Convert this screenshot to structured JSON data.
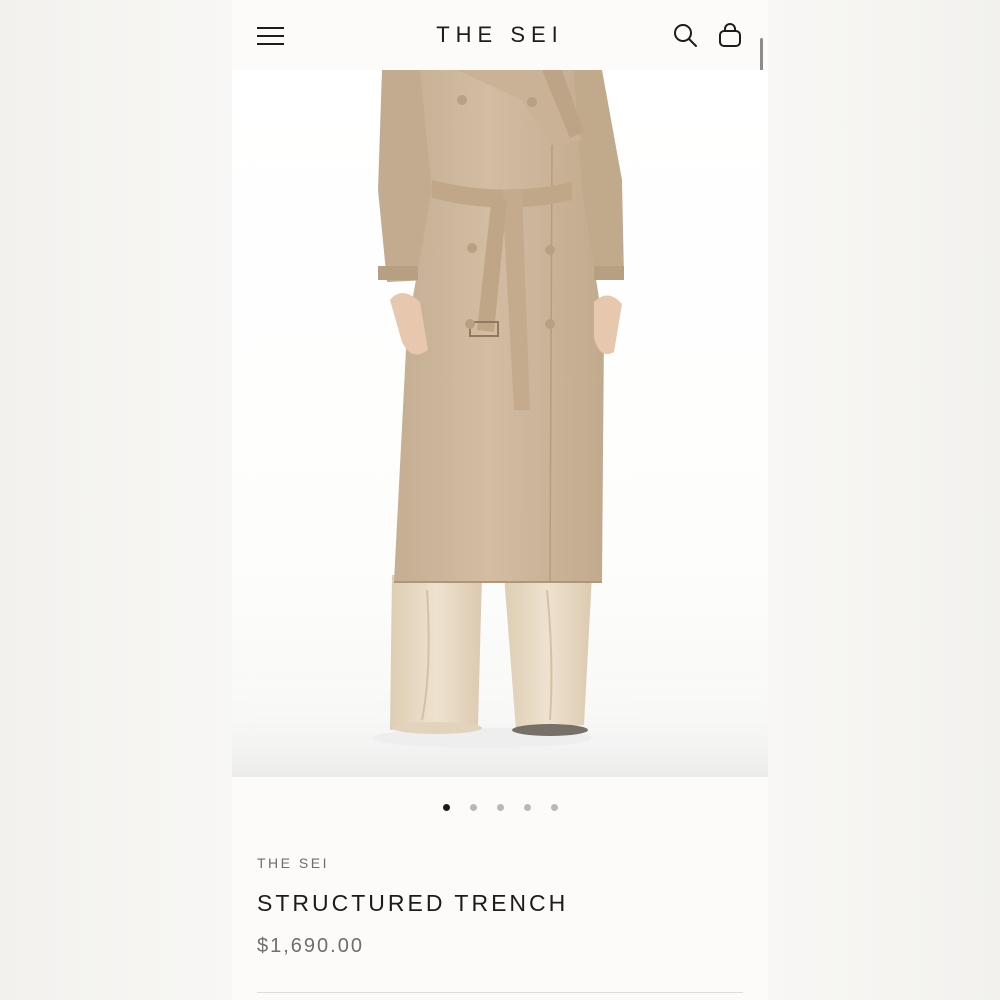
{
  "header": {
    "brand": "THE SEI",
    "menu_icon": "hamburger-menu-icon",
    "search_icon": "search-icon",
    "cart_icon": "shopping-bag-icon"
  },
  "gallery": {
    "image_subject": "model wearing beige belted trench coat over cream wide-leg trousers",
    "slide_count": 5,
    "active_slide": 1
  },
  "product": {
    "vendor": "THE SEI",
    "title": "STRUCTURED TRENCH",
    "price": "$1,690.00"
  },
  "colors": {
    "background": "#fcfbf9",
    "text": "#1c1c1c",
    "muted_text": "#6e6e6e",
    "coat": "#cdb79c",
    "trousers": "#e9dcc7"
  }
}
